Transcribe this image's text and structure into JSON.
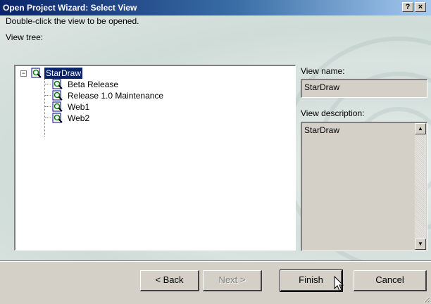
{
  "window": {
    "title": "Open Project Wizard: Select View",
    "help_label": "?",
    "close_label": "×"
  },
  "instructions": "Double-click the view to be opened.",
  "tree_label": "View tree:",
  "tree": {
    "root": "StarDraw",
    "root_expander": "−",
    "children": [
      "Beta Release",
      "Release 1.0 Maintenance",
      "Web1",
      "Web2"
    ]
  },
  "view_name": {
    "label": "View name:",
    "value": "StarDraw"
  },
  "view_description": {
    "label": "View description:",
    "value": "StarDraw"
  },
  "buttons": {
    "back": "< Back",
    "next": "Next >",
    "finish": "Finish",
    "cancel": "Cancel"
  },
  "colors": {
    "selection": "#0a246a",
    "titlebar_start": "#0a246a",
    "titlebar_end": "#a6caf0",
    "dialog_face": "#d4d0c8"
  },
  "icons": {
    "view_node": "view-icon",
    "cursor": "arrow-cursor"
  }
}
